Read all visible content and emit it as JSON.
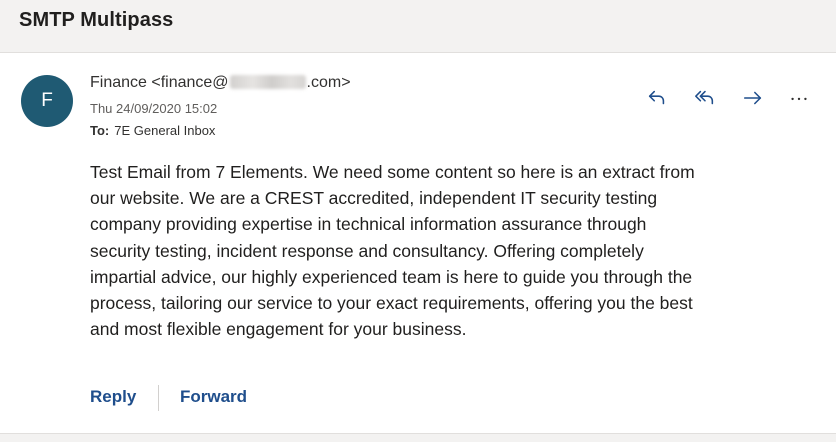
{
  "subject": "SMTP Multipass",
  "message": {
    "avatar_initial": "F",
    "sender_prefix": "Finance <finance@",
    "sender_suffix": ".com>",
    "date": "Thu 24/09/2020 15:02",
    "to_label": "To:",
    "to_value": "7E General Inbox",
    "body_lines": [
      "Test Email from 7 Elements. We need some content so here is an extract from",
      "our website. We are a CREST accredited, independent IT security testing",
      "company providing expertise in technical information assurance through",
      "security testing, incident response and consultancy. Offering completely",
      "impartial advice, our highly experienced team is here to guide you through the",
      "process, tailoring our service to your exact requirements, offering you the best",
      "and most flexible engagement for your business."
    ]
  },
  "toolbar_icons": [
    "reply-icon",
    "reply-all-icon",
    "forward-icon",
    "more-icon"
  ],
  "footer": {
    "reply_label": "Reply",
    "forward_label": "Forward"
  },
  "colors": {
    "avatar": "#1f5a73",
    "accent": "#1f4e8c",
    "icon": "#1f4e8c"
  }
}
